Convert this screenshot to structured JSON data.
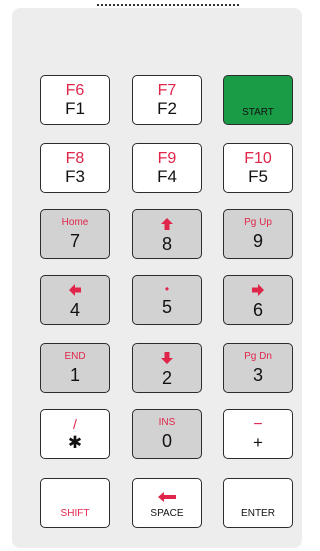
{
  "keypad": {
    "row1": {
      "k1": {
        "alt": "F6",
        "main": "F1"
      },
      "k2": {
        "alt": "F7",
        "main": "F2"
      },
      "k3": {
        "main": "START"
      }
    },
    "row2": {
      "k1": {
        "alt": "F8",
        "main": "F3"
      },
      "k2": {
        "alt": "F9",
        "main": "F4"
      },
      "k3": {
        "alt": "F10",
        "main": "F5"
      }
    },
    "row3": {
      "k1": {
        "alt": "Home",
        "main": "7"
      },
      "k2": {
        "main": "8"
      },
      "k3": {
        "alt": "Pg Up",
        "main": "9"
      }
    },
    "row4": {
      "k1": {
        "main": "4"
      },
      "k2": {
        "alt": "•",
        "main": "5"
      },
      "k3": {
        "main": "6"
      }
    },
    "row5": {
      "k1": {
        "alt": "END",
        "main": "1"
      },
      "k2": {
        "main": "2"
      },
      "k3": {
        "alt": "Pg Dn",
        "main": "3"
      }
    },
    "row6": {
      "k1": {
        "alt": "/",
        "main": "✱"
      },
      "k2": {
        "alt": "INS",
        "main": "0"
      },
      "k3": {
        "alt": "−",
        "main": "+"
      }
    },
    "row7": {
      "k1": {
        "main": "SHIFT"
      },
      "k2": {
        "main": "SPACE"
      },
      "k3": {
        "main": "ENTER"
      }
    }
  },
  "icons": {
    "up": "arrow-up-icon",
    "down": "arrow-down-icon",
    "left": "arrow-left-icon",
    "right": "arrow-right-icon",
    "backspace": "backspace-arrow-icon"
  },
  "colors": {
    "accent": "#e0254a",
    "start": "#1a9b45",
    "gray_key": "#d2d2d2"
  }
}
